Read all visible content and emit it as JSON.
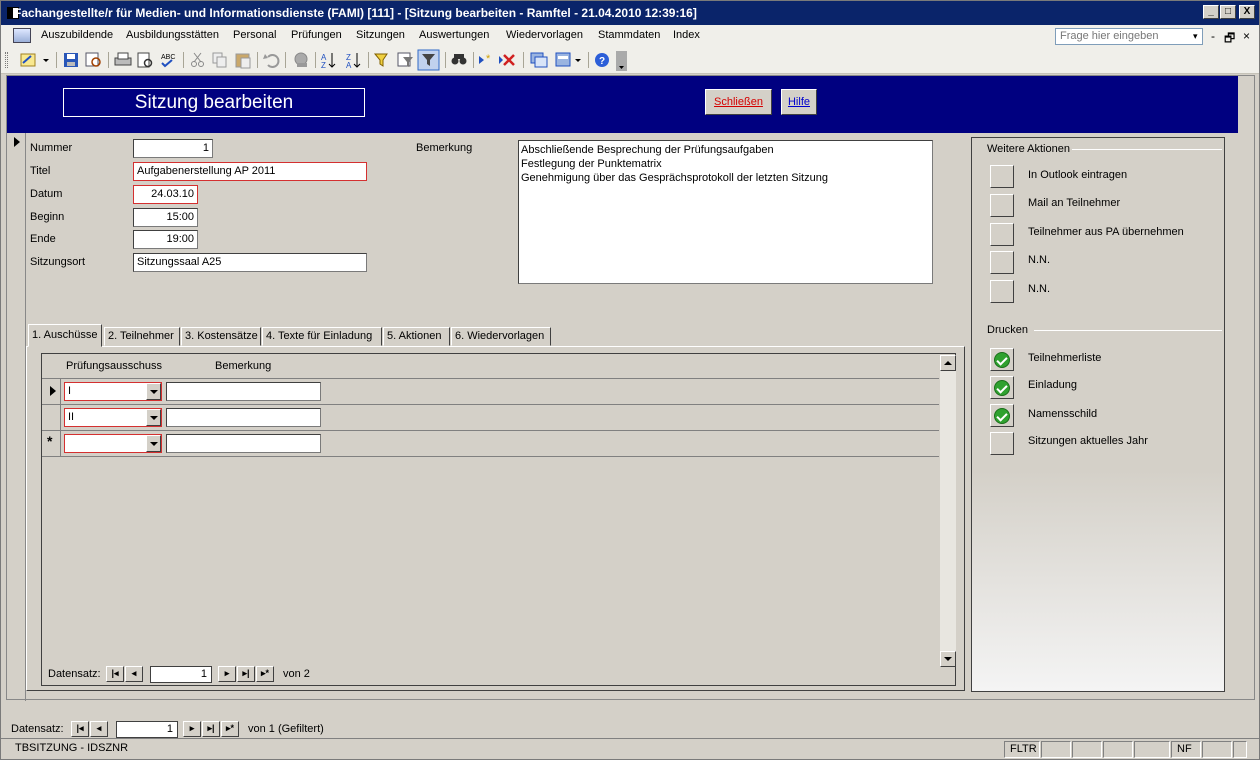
{
  "window": {
    "title": "Fachangestellte/r für Medien- und Informationsdienste (FAMI) [111] - [Sitzung bearbeiten - Ramftel - 21.04.2010 12:39:16]",
    "minimize": "_",
    "maximize": "□",
    "close": "X"
  },
  "menu": {
    "items": [
      {
        "label": "Auszubildende"
      },
      {
        "label": "Ausbildungsstätten"
      },
      {
        "label": "Personal"
      },
      {
        "label": "Prüfungen"
      },
      {
        "label": "Sitzungen"
      },
      {
        "label": "Auswertungen"
      },
      {
        "label": "Wiedervorlagen"
      },
      {
        "label": "Stammdaten"
      },
      {
        "label": "Index"
      }
    ],
    "ask_placeholder": "Frage hier eingeben",
    "mdi_min": "-",
    "mdi_restore": "🗗",
    "mdi_close": "×"
  },
  "toolbar": {
    "buttons": [
      "view-icon",
      "save-icon",
      "search-db-icon",
      "print-icon",
      "print-preview-icon",
      "spelling-icon",
      "cut-icon",
      "copy-icon",
      "paste-icon",
      "undo-icon",
      "hyperlink-icon",
      "sort-asc-icon",
      "sort-desc-icon",
      "filter-selection-icon",
      "filter-form-icon",
      "apply-filter-icon",
      "find-icon",
      "new-record-icon",
      "delete-record-icon",
      "database-window-icon",
      "new-object-icon",
      "help-icon"
    ]
  },
  "form": {
    "title": "Sitzung bearbeiten",
    "close_button": "Schließen",
    "help_button": "Hilfe",
    "fields": {
      "nummer_label": "Nummer",
      "nummer_value": "1",
      "titel_label": "Titel",
      "titel_value": "Aufgabenerstellung AP 2011",
      "datum_label": "Datum",
      "datum_value": "24.03.10",
      "beginn_label": "Beginn",
      "beginn_value": "15:00",
      "ende_label": "Ende",
      "ende_value": "19:00",
      "ort_label": "Sitzungsort",
      "ort_value": "Sitzungssaal A25",
      "bemerkung_label": "Bemerkung",
      "bemerkung_lines": [
        "Abschließende Besprechung der Prüfungsaufgaben",
        "Festlegung der Punktematrix",
        "Genehmigung über das Gesprächsprotokoll der letzten Sitzung"
      ]
    },
    "tabs": [
      {
        "label": "1. Auschüsse"
      },
      {
        "label": "2. Teilnehmer"
      },
      {
        "label": "3. Kostensätze"
      },
      {
        "label": "4. Texte für Einladung"
      },
      {
        "label": "5. Aktionen"
      },
      {
        "label": "6. Wiedervorlagen"
      }
    ],
    "subform": {
      "col_ausschuss": "Prüfungsausschuss",
      "col_bemerkung": "Bemerkung",
      "rows": [
        {
          "ausschuss": "I",
          "bemerkung": ""
        },
        {
          "ausschuss": "II",
          "bemerkung": ""
        },
        {
          "ausschuss": "",
          "bemerkung": ""
        }
      ],
      "nav_label": "Datensatz:",
      "nav_current": "1",
      "nav_total": "von  2"
    },
    "actions": {
      "title": "Weitere Aktionen",
      "items": [
        {
          "label": "In Outlook eintragen"
        },
        {
          "label": "Mail an Teilnehmer"
        },
        {
          "label": "Teilnehmer aus PA übernehmen"
        },
        {
          "label": "N.N."
        },
        {
          "label": "N.N."
        }
      ]
    },
    "print": {
      "title": "Drucken",
      "items": [
        {
          "label": "Teilnehmerliste",
          "checked": true
        },
        {
          "label": "Einladung",
          "checked": true
        },
        {
          "label": "Namensschild",
          "checked": true
        },
        {
          "label": "Sitzungen aktuelles Jahr",
          "checked": false
        }
      ]
    }
  },
  "main_nav": {
    "label": "Datensatz:",
    "current": "1",
    "total": "von  1 (Gefiltert)"
  },
  "status": {
    "left": "TBSITZUNG - IDSZNR",
    "fltr": "FLTR",
    "nf": "NF"
  },
  "nav_symbols": {
    "first": "|◂",
    "prev": "◂",
    "next": "▸",
    "last": "▸|",
    "new": "▸*",
    "new_row": "*"
  }
}
